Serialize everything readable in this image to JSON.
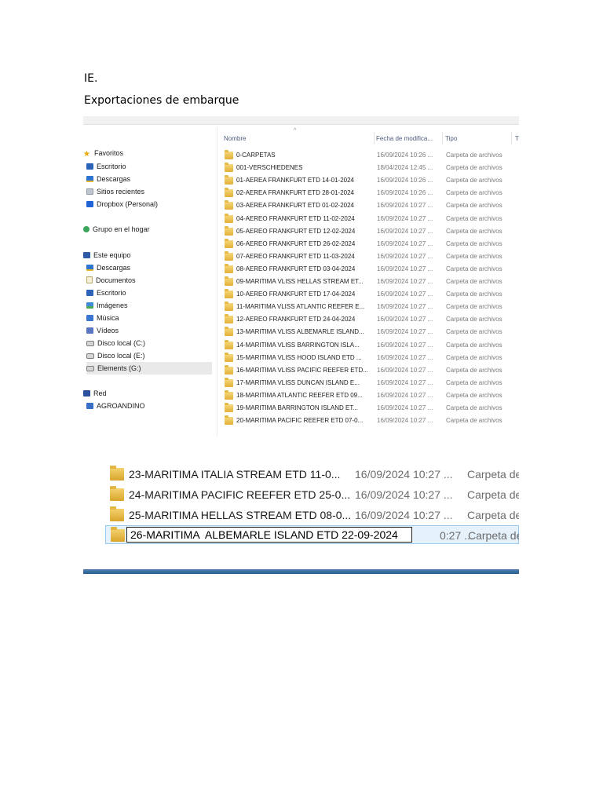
{
  "document": {
    "heading1": "IE.",
    "heading2": "Exportaciones de embarque"
  },
  "explorer": {
    "nav": {
      "favorites_label": "Favoritos",
      "favorites": [
        "Escritorio",
        "Descargas",
        "Sitios recientes",
        "Dropbox (Personal)"
      ],
      "homegroup_label": "Grupo en el hogar",
      "computer_label": "Este equipo",
      "computer": [
        "Descargas",
        "Documentos",
        "Escritorio",
        "Imágenes",
        "Música",
        "Vídeos",
        "Disco local (C:)",
        "Disco local (E:)",
        "Elements (G:)"
      ],
      "network_label": "Red",
      "network": [
        "AGROANDINO"
      ]
    },
    "columns": {
      "name": "Nombre",
      "date": "Fecha de modifica...",
      "type": "Tipo",
      "extra": "T"
    },
    "rows": [
      {
        "name": "0-CARPETAS",
        "date": "16/09/2024 10:26 ...",
        "type": "Carpeta de archivos"
      },
      {
        "name": "001-VERSCHIEDENES",
        "date": "18/04/2024 12:45 ...",
        "type": "Carpeta de archivos"
      },
      {
        "name": "01-AEREA FRANKFURT ETD 14-01-2024",
        "date": "16/09/2024 10:26 ...",
        "type": "Carpeta de archivos"
      },
      {
        "name": "02-AEREA FRANKFURT ETD 28-01-2024",
        "date": "16/09/2024 10:26 ...",
        "type": "Carpeta de archivos"
      },
      {
        "name": "03-AEREA FRANKFURT ETD 01-02-2024",
        "date": "16/09/2024 10:27 ...",
        "type": "Carpeta de archivos"
      },
      {
        "name": "04-AEREO FRANKFURT ETD 11-02-2024",
        "date": "16/09/2024 10:27 ...",
        "type": "Carpeta de archivos"
      },
      {
        "name": "05-AEREO FRANKFURT ETD 12-02-2024",
        "date": "16/09/2024 10:27 ...",
        "type": "Carpeta de archivos"
      },
      {
        "name": "06-AEREO FRANKFURT ETD 26-02-2024",
        "date": "16/09/2024 10:27 ...",
        "type": "Carpeta de archivos"
      },
      {
        "name": "07-AEREO FRANKFURT ETD 11-03-2024",
        "date": "16/09/2024 10:27 ...",
        "type": "Carpeta de archivos"
      },
      {
        "name": "08-AEREO FRANKFURT ETD 03-04-2024",
        "date": "16/09/2024 10:27 ...",
        "type": "Carpeta de archivos"
      },
      {
        "name": "09-MARITIMA VLISS HELLAS STREAM ET...",
        "date": "16/09/2024 10:27 ...",
        "type": "Carpeta de archivos"
      },
      {
        "name": "10-AEREO FRANKFURT ETD 17-04-2024",
        "date": "16/09/2024 10:27 ...",
        "type": "Carpeta de archivos"
      },
      {
        "name": "11-MARITIMA VLISS ATLANTIC REEFER E...",
        "date": "16/09/2024 10:27 ...",
        "type": "Carpeta de archivos"
      },
      {
        "name": "12-AEREO FRANKFURT ETD 24-04-2024",
        "date": "16/09/2024 10:27 ...",
        "type": "Carpeta de archivos"
      },
      {
        "name": "13-MARITIMA VLISS ALBEMARLE ISLAND...",
        "date": "16/09/2024 10:27 ...",
        "type": "Carpeta de archivos"
      },
      {
        "name": "14-MARITIMA VLISS BARRINGTON ISLA...",
        "date": "16/09/2024 10:27 ...",
        "type": "Carpeta de archivos"
      },
      {
        "name": "15-MARITIMA VLISS HOOD ISLAND ETD ...",
        "date": "16/09/2024 10:27 ...",
        "type": "Carpeta de archivos"
      },
      {
        "name": "16-MARITIMA VLISS PACIFIC REEFER ETD...",
        "date": "16/09/2024 10:27 ...",
        "type": "Carpeta de archivos"
      },
      {
        "name": "17-MARITIMA VLISS DUNCAN ISLAND E...",
        "date": "16/09/2024 10:27 ...",
        "type": "Carpeta de archivos"
      },
      {
        "name": "18-MARITIMA ATLANTIC REEFER ETD 09...",
        "date": "16/09/2024 10:27 ...",
        "type": "Carpeta de archivos"
      },
      {
        "name": "19-MARITIMA BARRINGTON ISLAND ET...",
        "date": "16/09/2024 10:27 ...",
        "type": "Carpeta de archivos"
      },
      {
        "name": "20-MARITIMA PACIFIC REEFER ETD 07-0...",
        "date": "16/09/2024 10:27 ...",
        "type": "Carpeta de archivos"
      }
    ]
  },
  "zoom": {
    "rows": [
      {
        "name": "23-MARITIMA ITALIA STREAM ETD  11-0...",
        "date": "16/09/2024 10:27 ...",
        "type": "Carpeta de"
      },
      {
        "name": "24-MARITIMA PACIFIC REEFER  ETD 25-0...",
        "date": "16/09/2024 10:27 ...",
        "type": "Carpeta de"
      },
      {
        "name": "25-MARITIMA HELLAS STREAM ETD 08-0...",
        "date": "16/09/2024 10:27 ...",
        "type": "Carpeta de"
      }
    ],
    "editing": {
      "value": "26-MARITIMA  ALBEMARLE ISLAND ETD 22-09-2024",
      "date": "0:27 ...",
      "type": "Carpeta de"
    }
  }
}
